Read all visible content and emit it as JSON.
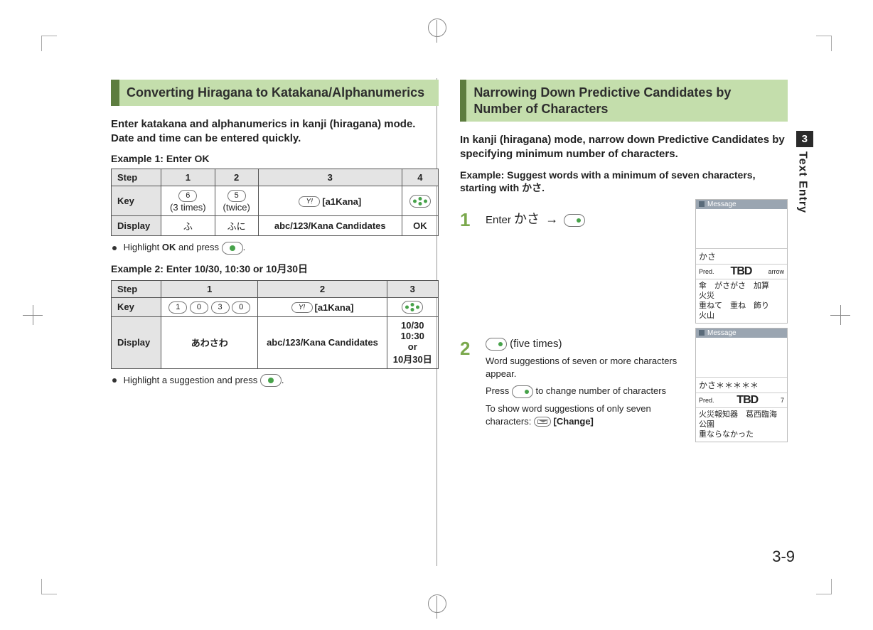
{
  "side": {
    "chapter": "3",
    "label": "Text Entry"
  },
  "pageNumber": "3-9",
  "left": {
    "title": "Converting Hiragana to Katakana/Alphanumerics",
    "intro": "Enter katakana and alphanumerics in kanji (hiragana) mode. Date and time can be entered quickly.",
    "ex1Label": "Example 1: Enter OK",
    "table1": {
      "head": [
        "Step",
        "1",
        "2",
        "3",
        "4"
      ],
      "keyRow": {
        "label": "Key",
        "c1": "6",
        "c1sub": "(3 times)",
        "c2": "5",
        "c2sub": "(twice)",
        "c3": "Y!",
        "c3label": "[a1Kana]",
        "c4": "arrows"
      },
      "dispRow": {
        "label": "Display",
        "c1": "ふ",
        "c2": "ふに",
        "c3": "abc/123/Kana Candidates",
        "c4": "OK"
      }
    },
    "bullet1a": "Highlight ",
    "bullet1b": "OK",
    "bullet1c": " and press ",
    "ex2Label": "Example 2: Enter 10/30, 10:30 or 10月30日",
    "table2": {
      "head": [
        "Step",
        "1",
        "2",
        "3"
      ],
      "keyRow": {
        "label": "Key",
        "keys": [
          "1",
          "0",
          "3",
          "0"
        ],
        "c2": "Y!",
        "c2label": "[a1Kana]",
        "c3": "arrows"
      },
      "dispRow": {
        "label": "Display",
        "c1": "あわさわ",
        "c2": "abc/123/Kana Candidates",
        "c3": "10/30\n10:30\nor\n10月30日"
      }
    },
    "bullet2": "Highlight a suggestion and press "
  },
  "right": {
    "title": "Narrowing Down Predictive Candidates by Number of Characters",
    "intro": "In kanji (hiragana) mode, narrow down Predictive Candidates by specifying minimum number of characters.",
    "exLabel": "Example: Suggest words with a minimum of seven characters, starting with かさ.",
    "step1": {
      "num": "1",
      "text_a": "Enter ",
      "text_b": "かさ"
    },
    "step2": {
      "num": "2",
      "main": " (five times)",
      "sub1": "Word suggestions of seven or more characters appear.",
      "b1": "Press ",
      "b1_tail": " to change number of characters",
      "b2": "To show word suggestions of only seven characters: ",
      "b2_key": "[Change]"
    },
    "shot1": {
      "titlebar": "Message",
      "input": "かさ",
      "pred_l": "Pred.",
      "pred_c": "TBD",
      "pred_r": "arrow",
      "cand_line1": "傘　がさがさ　加算　火災",
      "cand_line2": "重ねて　重ね　飾り　火山"
    },
    "shot2": {
      "titlebar": "Message",
      "input": "かさ＊＊＊＊＊",
      "pred_l": "Pred.",
      "pred_c": "TBD",
      "pred_r": "7",
      "cand_line1": "火災報知器　葛西臨海公園",
      "cand_line2": "重ならなかった"
    }
  }
}
